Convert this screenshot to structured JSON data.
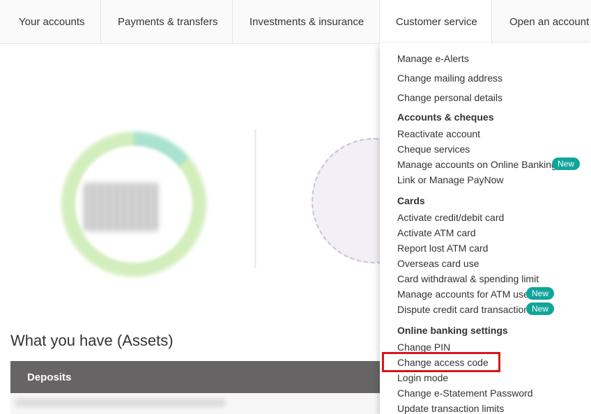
{
  "nav": {
    "tabs": [
      {
        "label": "Your accounts"
      },
      {
        "label": "Payments & transfers"
      },
      {
        "label": "Investments & insurance"
      },
      {
        "label": "Customer service"
      },
      {
        "label": "Open an account"
      }
    ],
    "active_tab": "Customer service"
  },
  "main": {
    "assets_title": "What you have (Assets)",
    "deposits_label": "Deposits"
  },
  "dropdown": {
    "items_top": [
      "Manage e-Alerts",
      "Change mailing address",
      "Change personal details"
    ],
    "sections": [
      {
        "heading": "Accounts & cheques",
        "items": [
          {
            "label": "Reactivate account"
          },
          {
            "label": "Cheque services"
          },
          {
            "label": "Manage accounts on Online Banking",
            "badge": "New"
          },
          {
            "label": "Link or Manage PayNow"
          }
        ]
      },
      {
        "heading": "Cards",
        "items": [
          {
            "label": "Activate credit/debit card"
          },
          {
            "label": "Activate ATM card"
          },
          {
            "label": "Report lost ATM card"
          },
          {
            "label": "Overseas card use"
          },
          {
            "label": "Card withdrawal & spending limit"
          },
          {
            "label": "Manage accounts for ATM use",
            "badge": "New"
          },
          {
            "label": "Dispute credit card transaction",
            "badge": "New"
          }
        ]
      },
      {
        "heading": "Online banking settings",
        "items": [
          {
            "label": "Change PIN"
          },
          {
            "label": "Change access code",
            "highlighted": true
          },
          {
            "label": "Login mode"
          },
          {
            "label": "Change e-Statement Password"
          },
          {
            "label": "Update transaction limits"
          }
        ]
      }
    ]
  },
  "colors": {
    "badge": "#10a59b",
    "highlight": "#d9161c",
    "deposits_bar": "#666464"
  }
}
